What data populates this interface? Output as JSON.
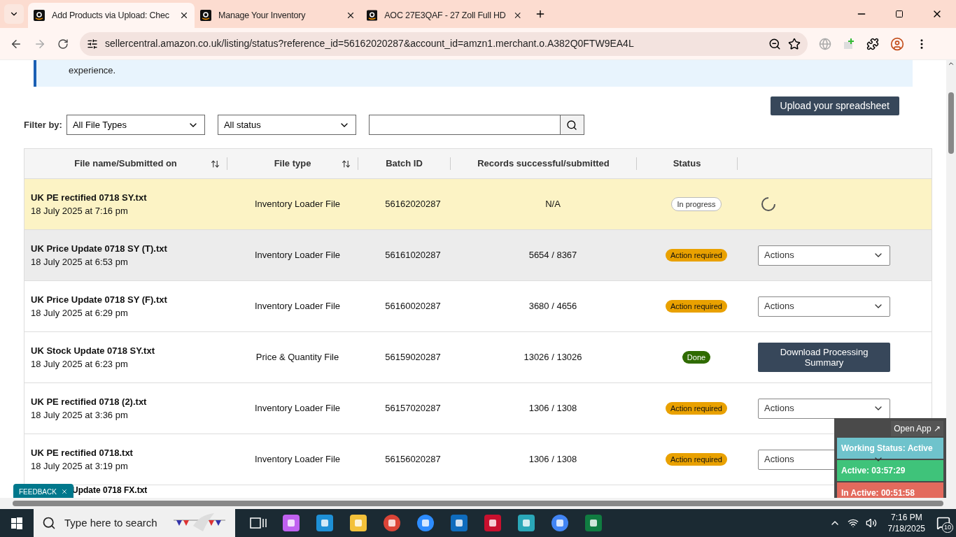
{
  "browser": {
    "tabs": [
      {
        "title": "Add Products via Upload: Chec",
        "selected": true
      },
      {
        "title": "Manage Your Inventory",
        "selected": false
      },
      {
        "title": "AOC 27E3QAF - 27 Zoll Full HD",
        "selected": false
      }
    ],
    "url": "sellercentral.amazon.co.uk/listing/status?reference_id=56162020287&account_id=amzn1.merchant.o.A382Q0FTW9EA4L"
  },
  "banner": {
    "text": "experience."
  },
  "upload_button": "Upload your spreadsheet",
  "filter": {
    "label": "Filter by:",
    "file_type": "All File Types",
    "status": "All status"
  },
  "table": {
    "columns": [
      {
        "label": "File name/Submitted on",
        "sortable": true
      },
      {
        "label": "File type",
        "sortable": true
      },
      {
        "label": "Batch ID",
        "sortable": false
      },
      {
        "label": "Records successful/submitted",
        "sortable": false
      },
      {
        "label": "Status",
        "sortable": false
      }
    ],
    "rows": [
      {
        "name": "UK PE rectified 0718 SY.txt",
        "date": "18 July 2025 at 7:16 pm",
        "type": "Inventory Loader File",
        "batch": "56162020287",
        "records": "N/A",
        "status": {
          "kind": "progress",
          "label": "In progress"
        },
        "action": {
          "kind": "spinner"
        },
        "hovered": false
      },
      {
        "name": "UK Price Update 0718 SY (T).txt",
        "date": "18 July 2025 at 6:53 pm",
        "type": "Inventory Loader File",
        "batch": "56161020287",
        "records": "5654 / 8367",
        "status": {
          "kind": "warning",
          "label": "Action required"
        },
        "action": {
          "kind": "dropdown",
          "label": "Actions"
        },
        "hovered": true
      },
      {
        "name": "UK Price Update 0718 SY (F).txt",
        "date": "18 July 2025 at 6:29 pm",
        "type": "Inventory Loader File",
        "batch": "56160020287",
        "records": "3680 / 4656",
        "status": {
          "kind": "warning",
          "label": "Action required"
        },
        "action": {
          "kind": "dropdown",
          "label": "Actions"
        },
        "hovered": false
      },
      {
        "name": "UK Stock Update 0718 SY.txt",
        "date": "18 July 2025 at 6:23 pm",
        "type": "Price & Quantity File",
        "batch": "56159020287",
        "records": "13026 / 13026",
        "status": {
          "kind": "done",
          "label": "Done"
        },
        "action": {
          "kind": "button",
          "label": "Download Processing Summary"
        },
        "hovered": false
      },
      {
        "name": "UK PE rectified 0718 (2).txt",
        "date": "18 July 2025 at 3:36 pm",
        "type": "Inventory Loader File",
        "batch": "56157020287",
        "records": "1306 / 1308",
        "status": {
          "kind": "warning",
          "label": "Action required"
        },
        "action": {
          "kind": "dropdown",
          "label": "Actions"
        },
        "hovered": false
      },
      {
        "name": "UK PE rectified 0718.txt",
        "date": "18 July 2025 at 3:19 pm",
        "type": "Inventory Loader File",
        "batch": "56156020287",
        "records": "1306 / 1308",
        "status": {
          "kind": "warning",
          "label": "Action required"
        },
        "action": {
          "kind": "dropdown",
          "label": "Actions"
        },
        "hovered": false
      }
    ],
    "partial_row": "Update 0718 FX.txt"
  },
  "feedback": "FEEDBACK",
  "tracker": {
    "open_app": "Open App ↗",
    "working_status": "Working Status: Active",
    "active": "Active: 03:57:29",
    "inactive": "In Active: 00:51:58"
  },
  "taskbar": {
    "search_placeholder": "Type here to search",
    "time": "7:16 PM",
    "date": "7/18/2025",
    "notifications": "10"
  }
}
